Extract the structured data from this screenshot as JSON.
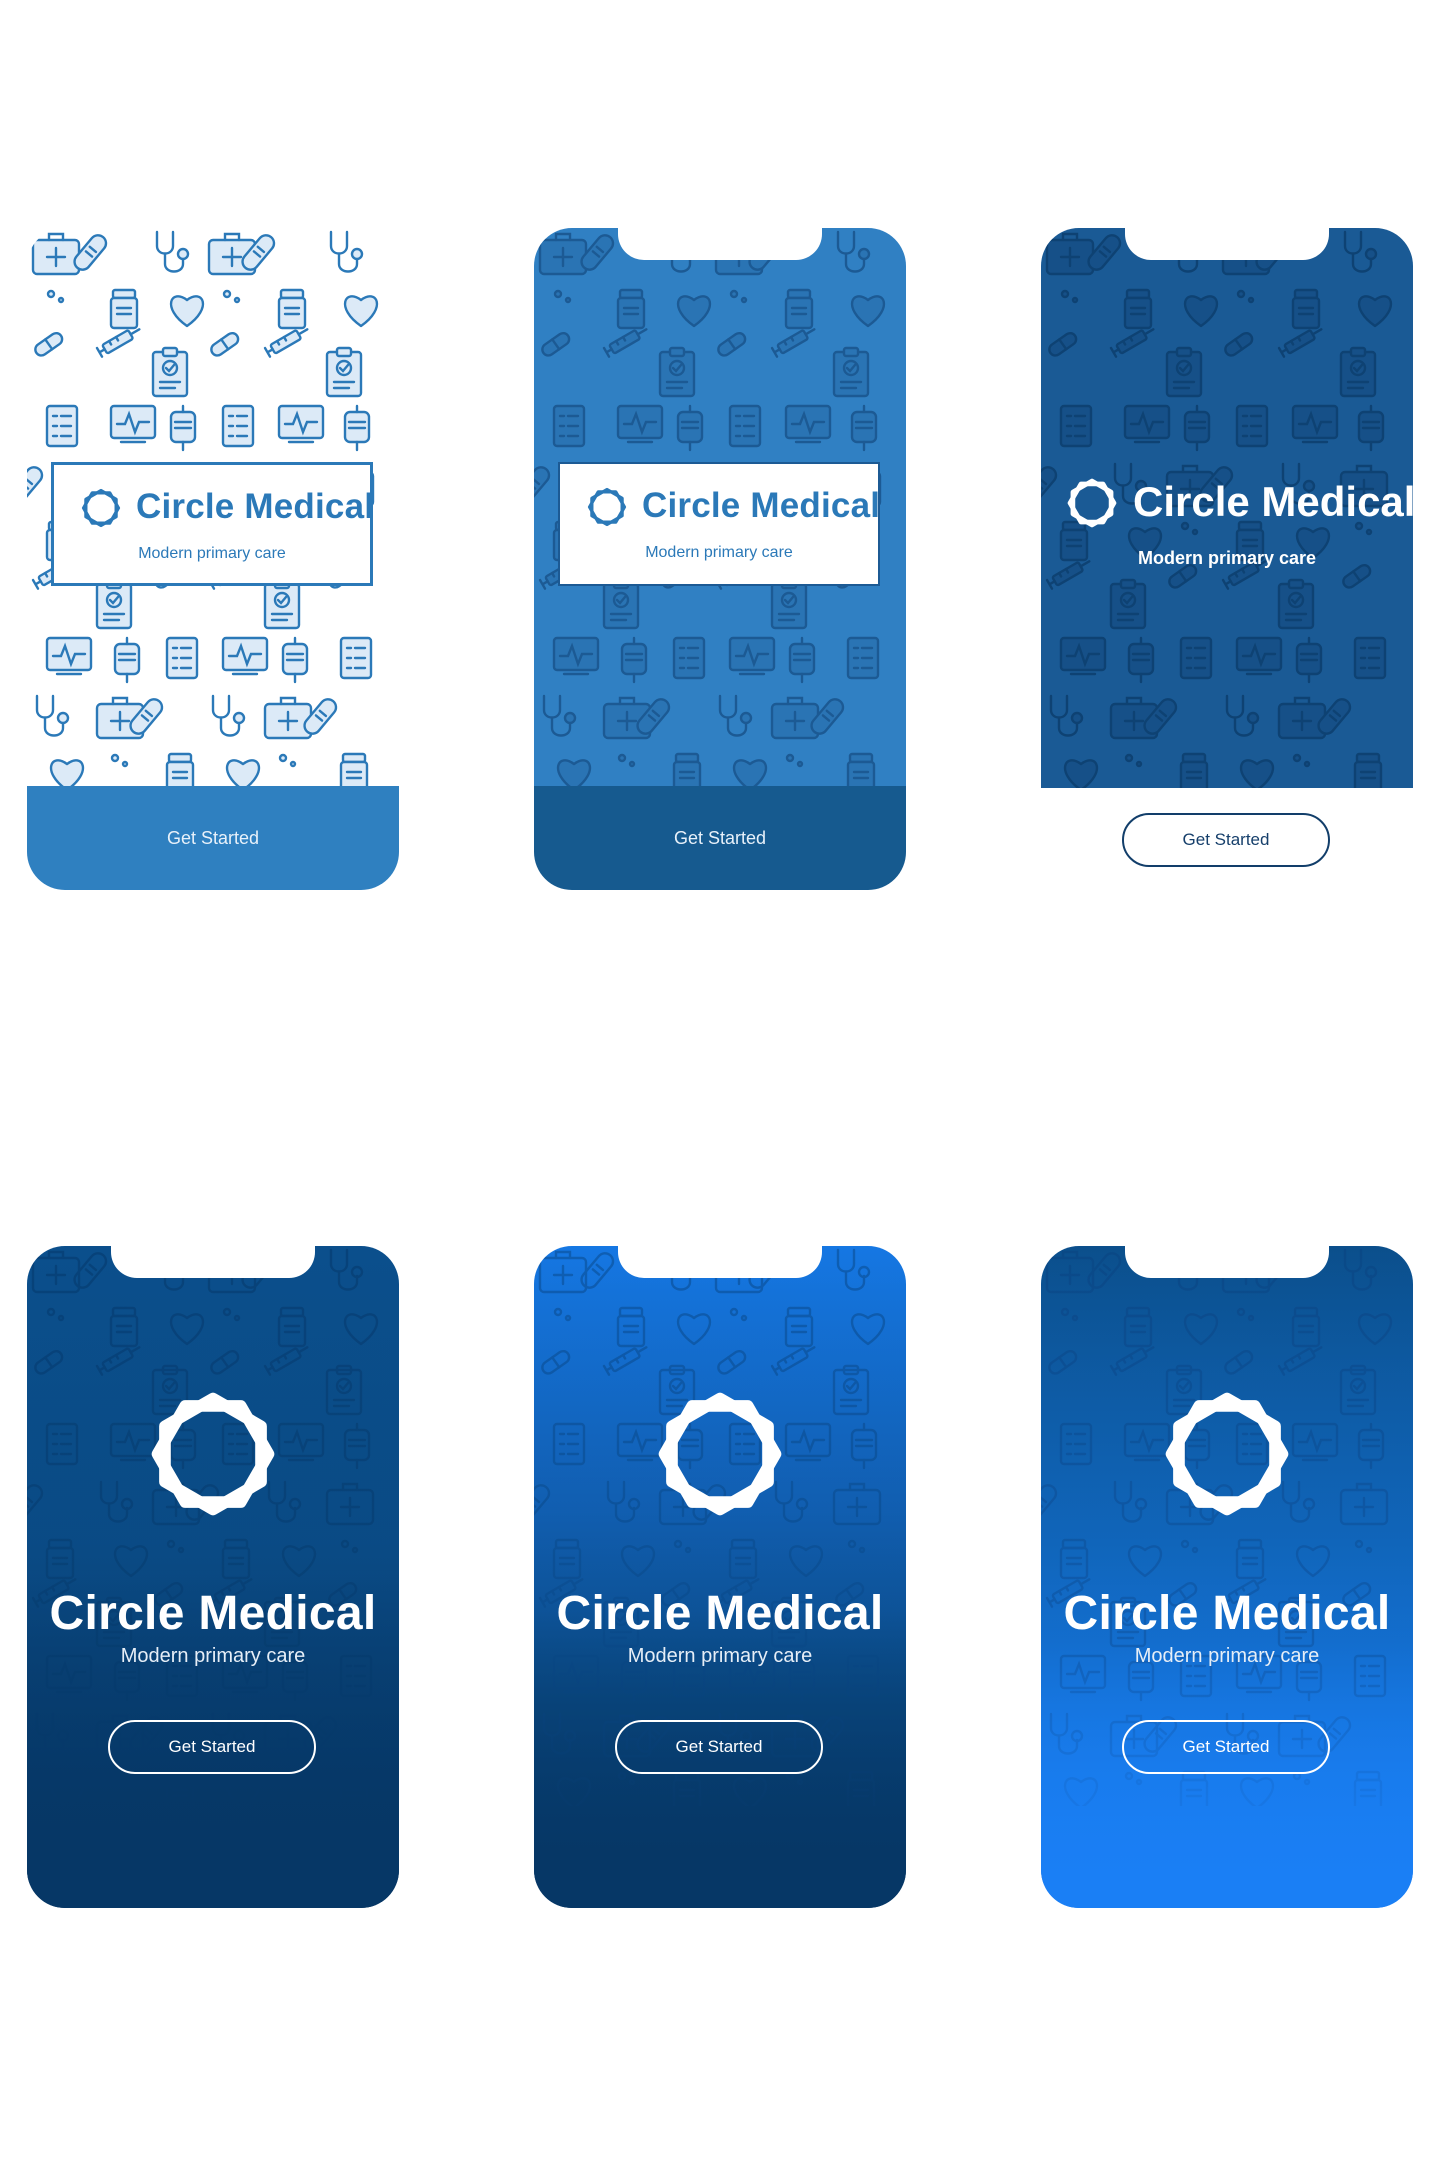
{
  "brand": {
    "name": "Circle Medical",
    "tagline": "Modern primary care",
    "cta": "Get Started"
  },
  "screens": [
    {
      "id": "v1",
      "style": "white-pattern-boxed",
      "pattern_bg": "#ffffff",
      "pattern_stroke": "#2b79b8",
      "bar_color": "#2f80c0"
    },
    {
      "id": "v2",
      "style": "blue-pattern-boxed",
      "pattern_bg": "#2f7ec1",
      "pattern_stroke": "#1e5d98",
      "bar_color": "#165a8f"
    },
    {
      "id": "v3",
      "style": "navy-pattern-inline",
      "pattern_bg": "#1a5a95",
      "pattern_stroke": "#0f4479",
      "button_border": "#0f3e6e"
    },
    {
      "id": "v4",
      "style": "navy-gradient-centered",
      "gradient": [
        "#0b4f8c",
        "#063766"
      ]
    },
    {
      "id": "v5",
      "style": "bright-to-navy-gradient",
      "gradient": [
        "#1577e3",
        "#063766"
      ]
    },
    {
      "id": "v6",
      "style": "navy-to-bright-gradient",
      "gradient": [
        "#0b4f8c",
        "#1a7ff5"
      ]
    }
  ],
  "icons": [
    "first-aid-kit-icon",
    "iv-bag-icon",
    "bandage-icon",
    "syringe-icon",
    "clipboard-icon",
    "heart-icon",
    "stethoscope-icon",
    "monitor-icon",
    "pill-bottle-icon",
    "microscope-icon",
    "tooth-icon",
    "pill-icon"
  ]
}
